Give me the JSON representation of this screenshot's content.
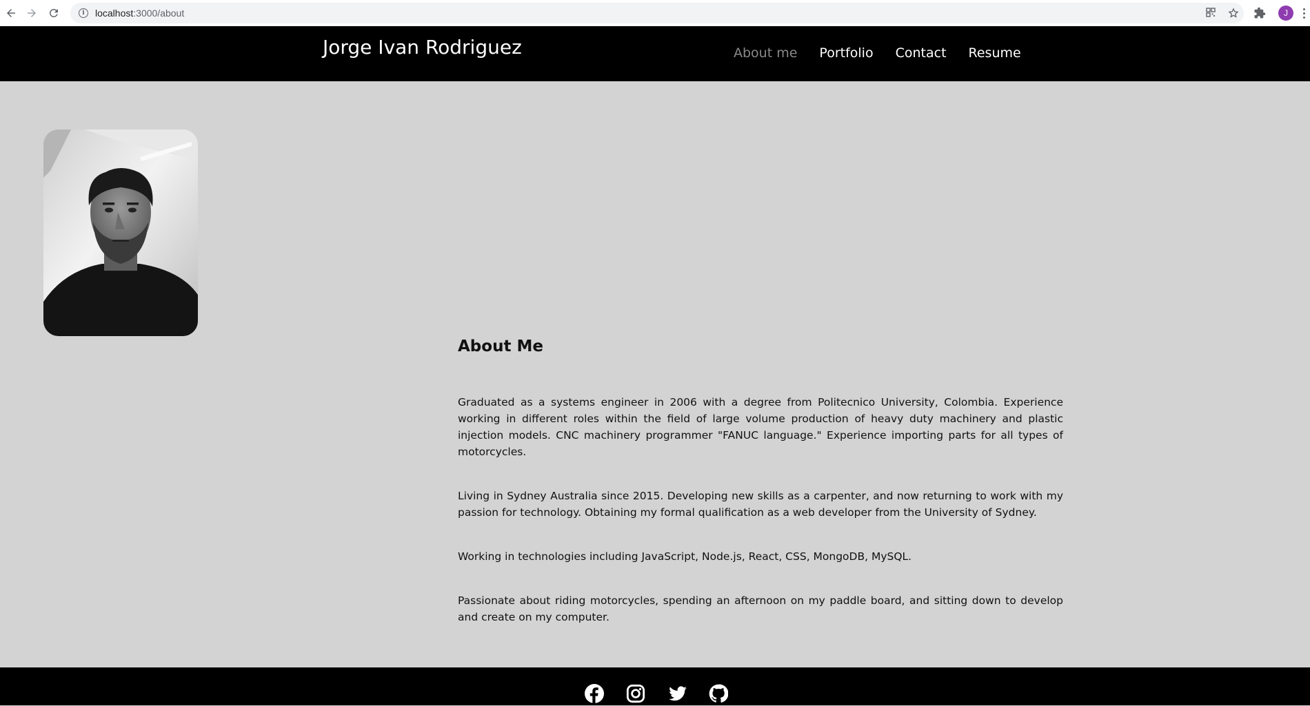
{
  "browser": {
    "url_host": "localhost",
    "url_path": ":3000/about",
    "profile_initial": "J",
    "icons": [
      "back-arrow-icon",
      "forward-arrow-icon",
      "reload-icon",
      "info-icon",
      "qr-code-icon",
      "star-icon",
      "puzzle-icon",
      "kebab-menu-icon"
    ]
  },
  "header": {
    "title": "Jorge Ivan Rodriguez",
    "nav": [
      {
        "label": "About me",
        "active": true
      },
      {
        "label": "Portfolio",
        "active": false
      },
      {
        "label": "Contact",
        "active": false
      },
      {
        "label": "Resume",
        "active": false
      }
    ]
  },
  "main": {
    "heading": "About Me",
    "paragraphs": [
      "Graduated as a systems engineer in 2006 with a degree from Politecnico University, Colombia. Experience working in different roles within the field of large volume production of heavy duty machinery and plastic injection models. CNC machinery programmer \"FANUC language.\" Experience importing parts for all types of motorcycles.",
      "Living in Sydney Australia since 2015. Developing new skills as a carpenter, and now returning to work with my passion for technology. Obtaining my formal qualification as a web developer from the University of Sydney.",
      "Working in technologies including JavaScript, Node.js, React, CSS, MongoDB, MySQL.",
      "Passionate about riding motorcycles, spending an afternoon on my paddle board, and sitting down to develop and create on my computer."
    ]
  },
  "footer": {
    "social": [
      "facebook-icon",
      "instagram-icon",
      "twitter-icon",
      "github-icon"
    ]
  },
  "colors": {
    "page_bg": "#d3d3d3",
    "header_bg": "#000000",
    "nav_active": "#8a8a8a",
    "avatar_bg": "#8e3cb0"
  }
}
